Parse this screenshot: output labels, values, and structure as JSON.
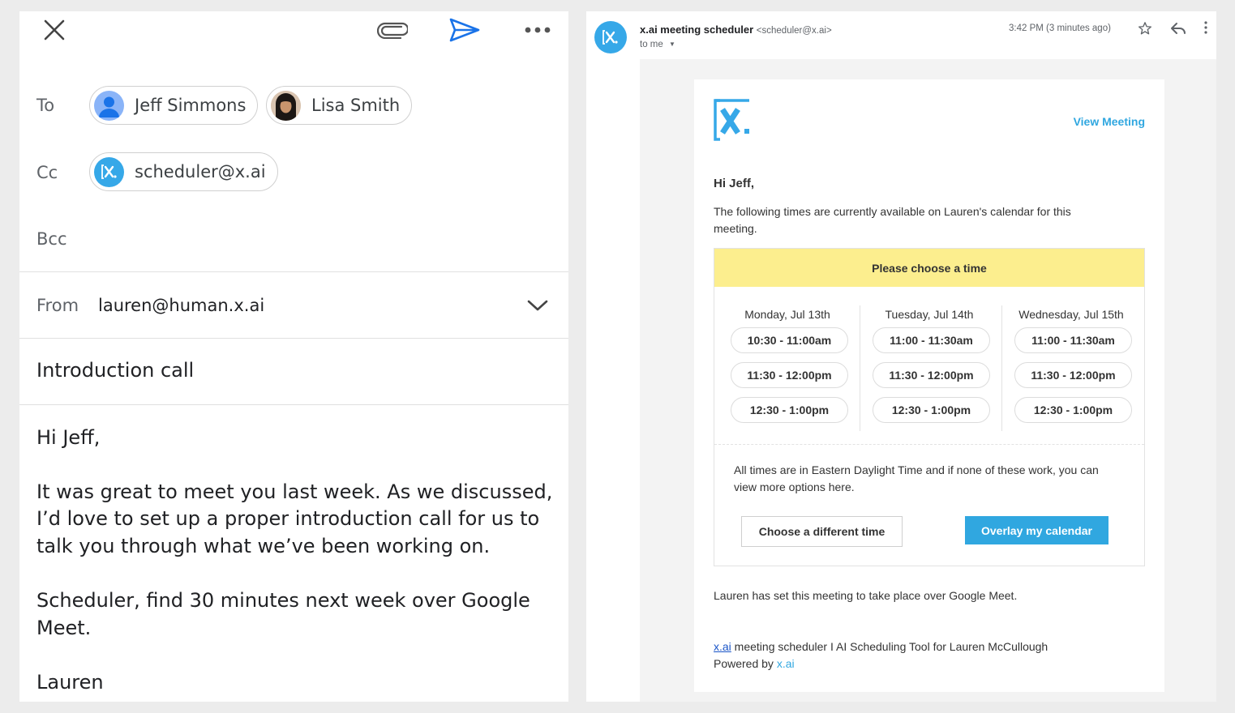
{
  "compose": {
    "icons": {
      "close": "close-icon",
      "attach": "paperclip-icon",
      "send": "send-icon",
      "more": "more-horiz-icon"
    },
    "to_label": "To",
    "to_recipients": [
      {
        "name": "Jeff Simmons",
        "avatar": "person-icon"
      },
      {
        "name": "Lisa Smith",
        "avatar": "photo"
      }
    ],
    "cc_label": "Cc",
    "cc_recipients": [
      {
        "name": "scheduler@x.ai",
        "avatar": "xai-logo"
      }
    ],
    "bcc_label": "Bcc",
    "from_label": "From",
    "from_value": "lauren@human.x.ai",
    "subject": "Introduction call",
    "body": {
      "greeting": "Hi Jeff,",
      "para1_line1": "It was great to meet you last week. As we discussed,",
      "para1_line2": "I’d love to set up a proper introduction call for us to",
      "para1_line3": "talk you through what we’ve been working on.",
      "para2_line1": "Scheduler, find 30 minutes next week over Google",
      "para2_line2": "Meet.",
      "signature": "Lauren"
    }
  },
  "email": {
    "sender_name": "x.ai meeting scheduler",
    "sender_addr": "<scheduler@x.ai>",
    "to_me": "to me",
    "time": "3:42 PM (3 minutes ago)",
    "view_meeting": "View Meeting",
    "greeting": "Hi Jeff,",
    "intro_line1": "The following times are currently available on Lauren's calendar for this",
    "intro_line2": "meeting.",
    "choose_header": "Please choose a time",
    "days": [
      {
        "label": "Monday, Jul 13th",
        "slots": [
          "10:30 - 11:00am",
          "11:30 - 12:00pm",
          "12:30 - 1:00pm"
        ]
      },
      {
        "label": "Tuesday, Jul 14th",
        "slots": [
          "11:00 - 11:30am",
          "11:30 - 12:00pm",
          "12:30 - 1:00pm"
        ]
      },
      {
        "label": "Wednesday, Jul 15th",
        "slots": [
          "11:00 - 11:30am",
          "11:30 - 12:00pm",
          "12:30 - 1:00pm"
        ]
      }
    ],
    "tz_note_line1": "All times are in Eastern Daylight Time and if none of these work, you can",
    "tz_note_line2": "view more options here.",
    "btn_choose_different": "Choose a different time",
    "btn_overlay": "Overlay my calendar",
    "meet_note": "Lauren has set this meeting to take place over Google Meet.",
    "footer_link": "x.ai",
    "footer_rest": " meeting scheduler I AI Scheduling Tool for Lauren McCullough",
    "powered_by": "Powered by ",
    "powered_link": "x.ai"
  },
  "colors": {
    "accent_blue": "#30a7e0",
    "send_blue": "#1a73e8",
    "yellow": "#fcee8e"
  }
}
